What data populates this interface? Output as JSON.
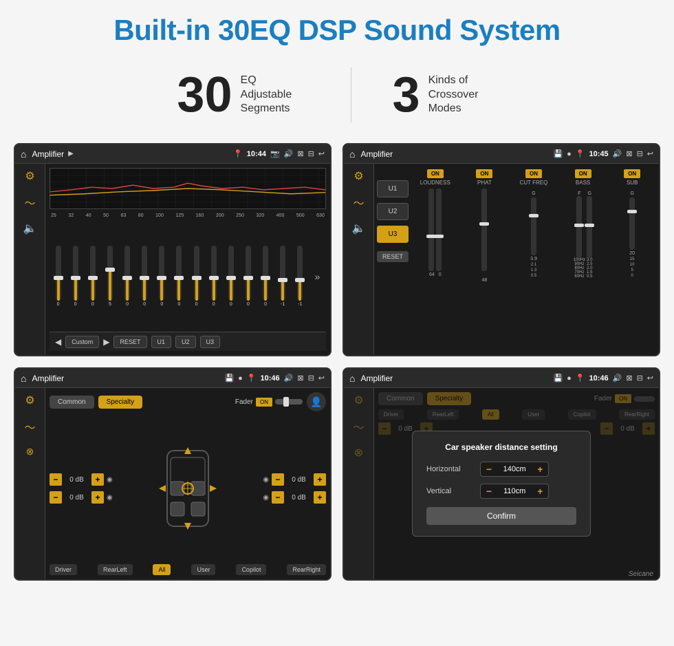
{
  "page": {
    "title": "Built-in 30EQ DSP Sound System",
    "stat1_number": "30",
    "stat1_label": "EQ Adjustable\nSegments",
    "stat2_number": "3",
    "stat2_label": "Kinds of\nCrossover Modes"
  },
  "screen1": {
    "title": "Amplifier",
    "time": "10:44",
    "freq_labels": [
      "25",
      "32",
      "40",
      "50",
      "63",
      "80",
      "100",
      "125",
      "160",
      "200",
      "250",
      "320",
      "400",
      "500",
      "630"
    ],
    "sliders": [
      {
        "val": "0",
        "pct": 50
      },
      {
        "val": "0",
        "pct": 50
      },
      {
        "val": "0",
        "pct": 50
      },
      {
        "val": "5",
        "pct": 58
      },
      {
        "val": "0",
        "pct": 50
      },
      {
        "val": "0",
        "pct": 50
      },
      {
        "val": "0",
        "pct": 50
      },
      {
        "val": "0",
        "pct": 50
      },
      {
        "val": "0",
        "pct": 50
      },
      {
        "val": "0",
        "pct": 50
      },
      {
        "val": "0",
        "pct": 50
      },
      {
        "val": "0",
        "pct": 50
      },
      {
        "val": "0",
        "pct": 50
      },
      {
        "val": "-1",
        "pct": 46
      },
      {
        "val": "-1",
        "pct": 46
      }
    ],
    "preset_label": "Custom",
    "btn_reset": "RESET",
    "btn_u1": "U1",
    "btn_u2": "U2",
    "btn_u3": "U3"
  },
  "screen2": {
    "title": "Amplifier",
    "time": "10:45",
    "channels": [
      "LOUDNESS",
      "PHAT",
      "CUT FREQ",
      "BASS",
      "SUB"
    ],
    "u_buttons": [
      "U1",
      "U2",
      "U3"
    ],
    "active_u": "U3",
    "btn_reset": "RESET"
  },
  "screen3": {
    "title": "Amplifier",
    "time": "10:46",
    "tab_common": "Common",
    "tab_specialty": "Specialty",
    "active_tab": "Specialty",
    "fader_label": "Fader",
    "fader_on": "ON",
    "db_controls": [
      {
        "label": "0 dB"
      },
      {
        "label": "0 dB"
      },
      {
        "label": "0 dB"
      },
      {
        "label": "0 dB"
      }
    ],
    "zone_btns": [
      "Driver",
      "RearLeft",
      "All",
      "User",
      "Copilot",
      "RearRight"
    ]
  },
  "screen4": {
    "title": "Amplifier",
    "time": "10:46",
    "dialog_title": "Car speaker distance setting",
    "horizontal_label": "Horizontal",
    "horizontal_value": "140cm",
    "vertical_label": "Vertical",
    "vertical_value": "110cm",
    "confirm_btn": "Confirm",
    "watermark": "Seicane"
  }
}
